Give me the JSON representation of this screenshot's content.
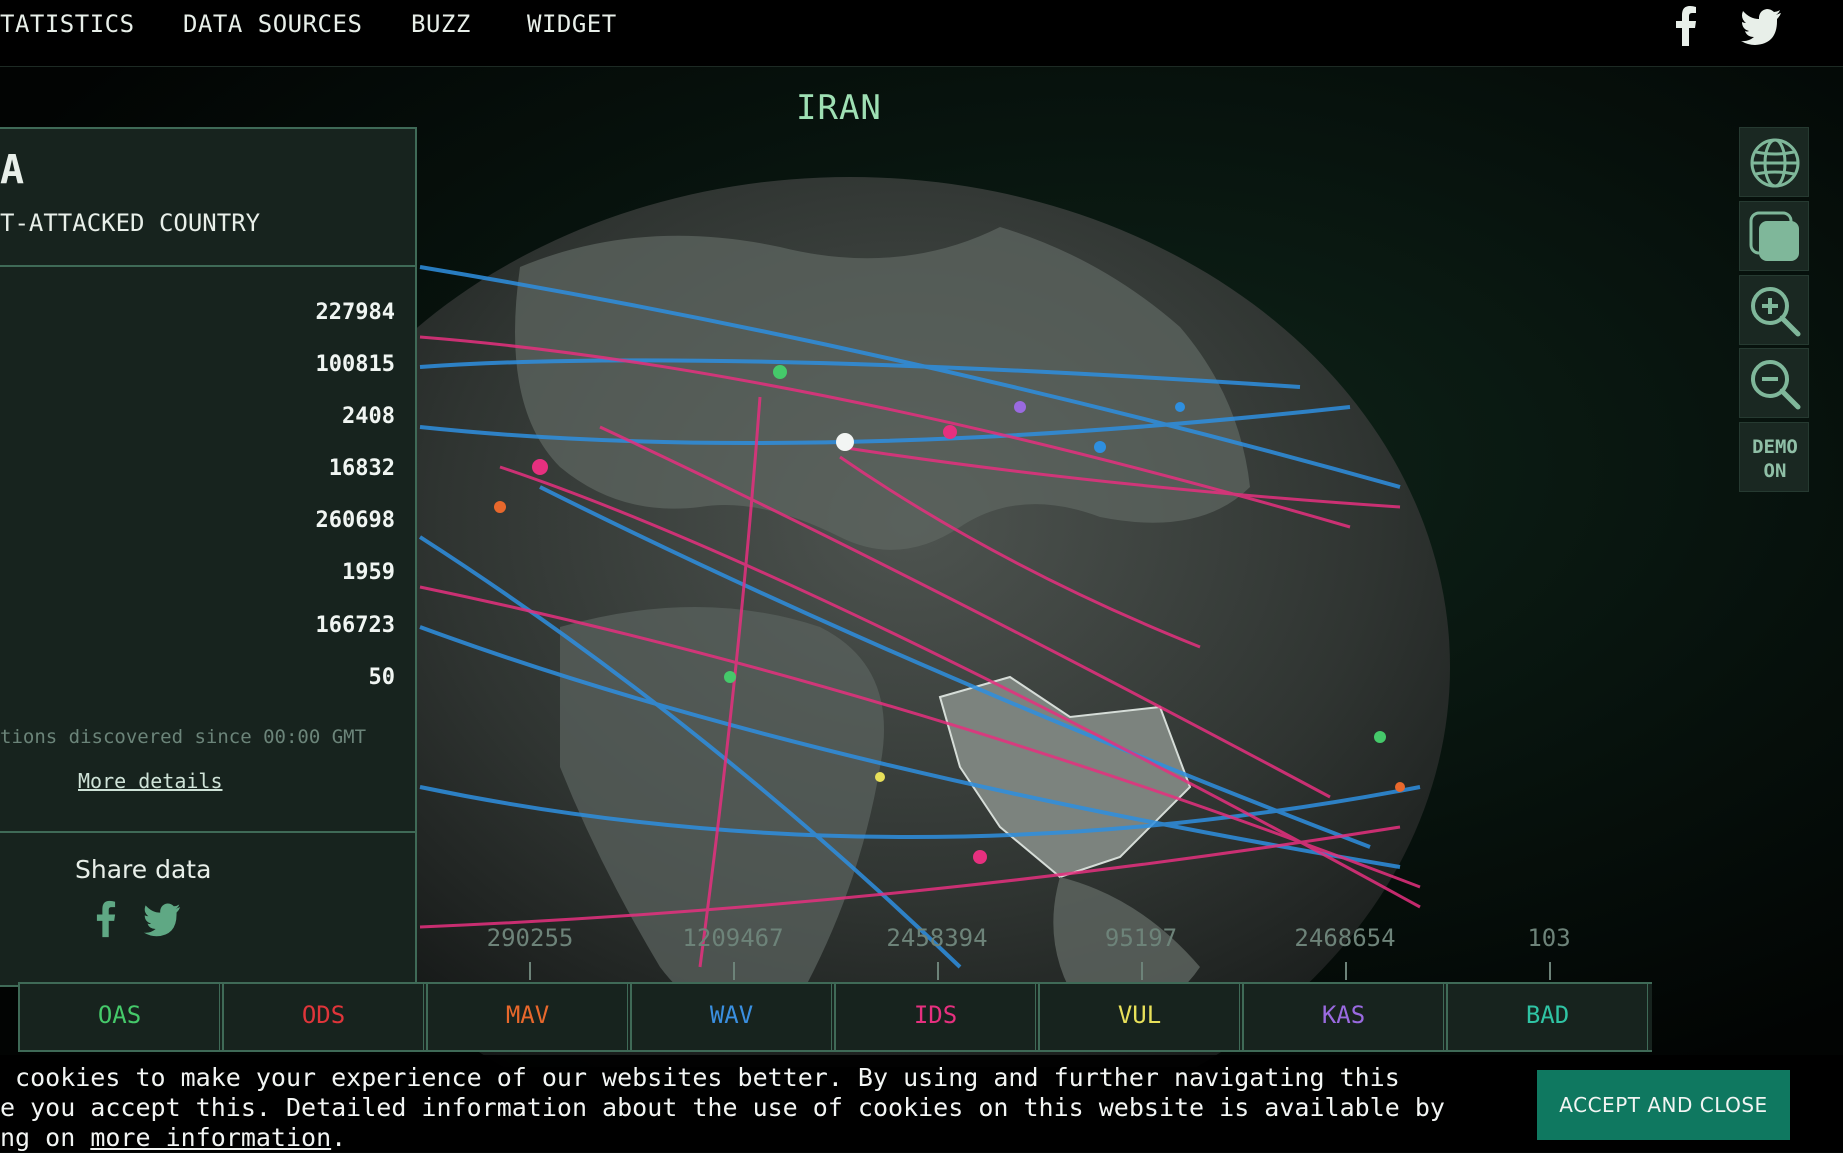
{
  "nav": {
    "items": [
      "TATISTICS",
      "DATA SOURCES",
      "BUZZ",
      "WIDGET"
    ],
    "facebook_icon": "facebook-icon",
    "twitter_icon": "twitter-icon"
  },
  "map": {
    "country_label": "IRAN"
  },
  "panel": {
    "title": "A",
    "subtitle": "T-ATTACKED COUNTRY",
    "stats": [
      "227984",
      "100815",
      "2408",
      "16832",
      "260698",
      "1959",
      "166723",
      "50"
    ],
    "footnote": "tions discovered since 00:00 GMT",
    "more_details": "More details",
    "share_title": "Share data"
  },
  "toolbar": {
    "globe_icon": "globe-icon",
    "flat_icon": "flat-map-icon",
    "zoom_in_icon": "zoom-in-icon",
    "zoom_out_icon": "zoom-out-icon",
    "demo_label": "DEMO\nON"
  },
  "legend": {
    "counts": [
      "290255",
      "1209467",
      "2458394",
      "95197",
      "2468654",
      "103"
    ],
    "items": [
      {
        "label": "OAS",
        "color": "#45c96a"
      },
      {
        "label": "ODS",
        "color": "#e0353a"
      },
      {
        "label": "MAV",
        "color": "#e8682c"
      },
      {
        "label": "WAV",
        "color": "#3a8fe0"
      },
      {
        "label": "IDS",
        "color": "#e6307f"
      },
      {
        "label": "VUL",
        "color": "#e8e05a"
      },
      {
        "label": "KAS",
        "color": "#9a6ae0"
      },
      {
        "label": "BAD",
        "color": "#2fc4a4"
      }
    ]
  },
  "cookie": {
    "line1": " cookies to make your experience of our websites better. By using and further navigating this",
    "line2": "e you accept this. Detailed information about the use of cookies on this website is available by",
    "line3_prefix": "ng on ",
    "link": "more information",
    "line3_suffix": ".",
    "accept": "ACCEPT AND CLOSE"
  }
}
